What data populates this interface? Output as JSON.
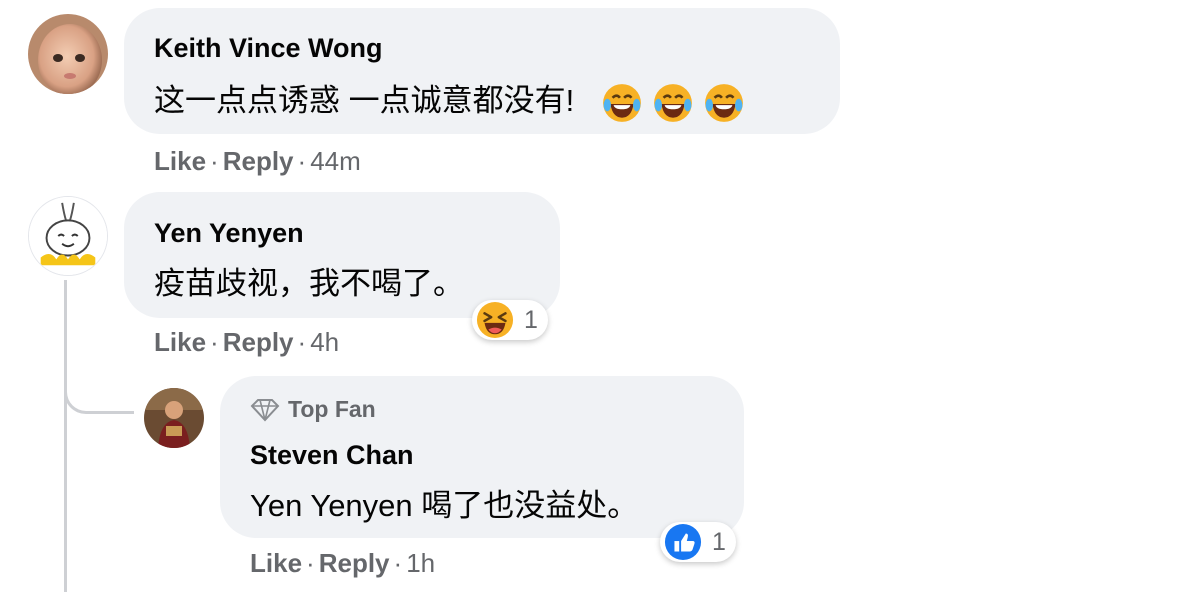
{
  "colors": {
    "bubble": "#f0f2f5",
    "meta": "#65676b",
    "like_blue": "#1877f2",
    "emoji_yellow": "#f7b125"
  },
  "comments": [
    {
      "author": "Keith Vince Wong",
      "text": "这一点点诱惑 一点诚意都没有!",
      "emojis": [
        "laughing-tears-icon",
        "laughing-tears-icon",
        "laughing-tears-icon"
      ],
      "actions": {
        "like": "Like",
        "reply": "Reply",
        "time": "44m"
      }
    },
    {
      "author": "Yen Yenyen",
      "text": "疫苗歧视，我不喝了。",
      "reaction": {
        "icon": "haha-reaction-icon",
        "count": "1"
      },
      "actions": {
        "like": "Like",
        "reply": "Reply",
        "time": "4h"
      }
    },
    {
      "badge": "Top Fan",
      "author": "Steven Chan",
      "mention": "Yen Yenyen",
      "text": " 喝了也没益处。",
      "reaction": {
        "icon": "like-reaction-icon",
        "count": "1"
      },
      "actions": {
        "like": "Like",
        "reply": "Reply",
        "time": "1h"
      }
    }
  ],
  "separator": "·"
}
